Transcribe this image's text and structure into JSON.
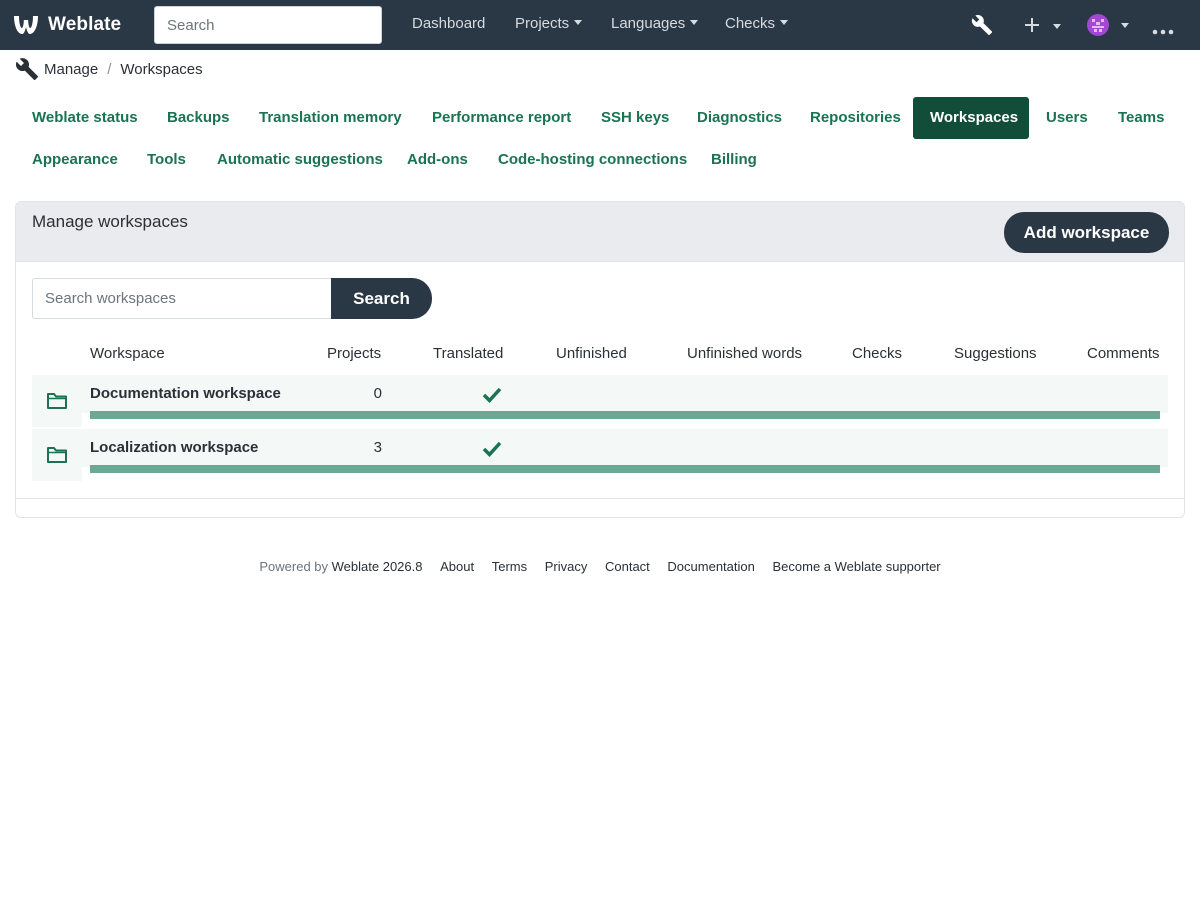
{
  "navbar": {
    "brand": "Weblate",
    "search_placeholder": "Search",
    "items": [
      {
        "label": "Dashboard"
      },
      {
        "label": "Projects"
      },
      {
        "label": "Languages"
      },
      {
        "label": "Checks"
      }
    ],
    "icons": [
      "wrench-icon",
      "plus-icon",
      "avatar",
      "more-icon"
    ]
  },
  "breadcrumb": {
    "root": "Manage",
    "current": "Workspaces"
  },
  "tabs": [
    {
      "label": "Weblate status"
    },
    {
      "label": "Backups"
    },
    {
      "label": "Translation memory"
    },
    {
      "label": "Performance report"
    },
    {
      "label": "SSH keys"
    },
    {
      "label": "Diagnostics"
    },
    {
      "label": "Repositories"
    },
    {
      "label": "Workspaces",
      "active": true
    },
    {
      "label": "Users"
    },
    {
      "label": "Teams"
    },
    {
      "label": "Appearance"
    },
    {
      "label": "Tools"
    },
    {
      "label": "Automatic suggestions"
    },
    {
      "label": "Add-ons"
    },
    {
      "label": "Code-hosting connections"
    },
    {
      "label": "Billing"
    }
  ],
  "card": {
    "title": "Manage workspaces",
    "add_button": "Add workspace",
    "search_placeholder": "Search workspaces",
    "search_button": "Search"
  },
  "table": {
    "headers": {
      "workspace": "Workspace",
      "projects": "Projects",
      "translated": "Translated",
      "unfinished": "Unfinished",
      "unfinished_words": "Unfinished words",
      "checks": "Checks",
      "suggestions": "Suggestions",
      "comments": "Comments"
    },
    "rows": [
      {
        "name": "Documentation workspace",
        "projects": "0",
        "translated_complete": true,
        "progress": 1.0
      },
      {
        "name": "Localization workspace",
        "projects": "3",
        "translated_complete": true,
        "progress": 1.0
      }
    ]
  },
  "footer": {
    "powered_by": "Powered by",
    "version": "Weblate 2026.8",
    "links": [
      "About",
      "Terms",
      "Privacy",
      "Contact",
      "Documentation",
      "Become a Weblate supporter"
    ]
  },
  "colors": {
    "navbar_bg": "#2a3744",
    "accent_green": "#1a7352",
    "active_tab": "#114d39",
    "progress": "#6aa994"
  }
}
